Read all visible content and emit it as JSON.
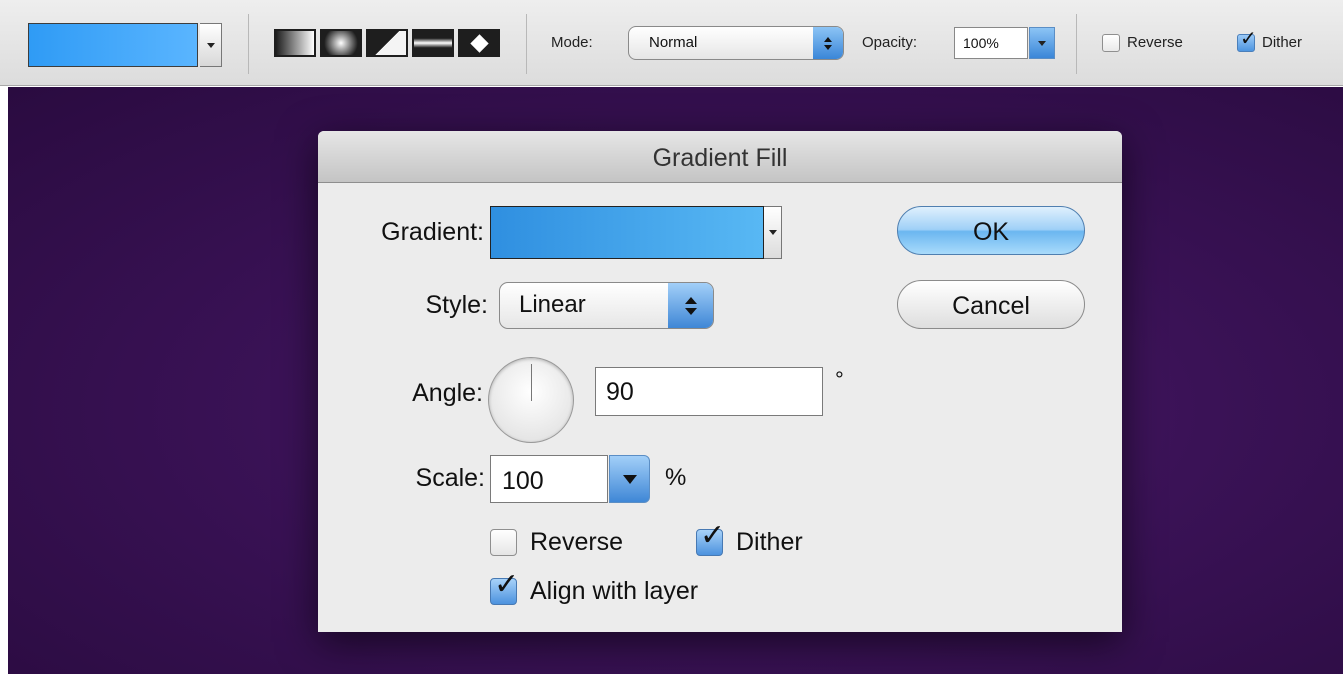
{
  "toolbar": {
    "gradient_colors": [
      "#2f9bf5",
      "#5ab5ff"
    ],
    "gradient_types": [
      "linear-gradient-icon",
      "radial-gradient-icon",
      "angle-gradient-icon",
      "reflected-gradient-icon",
      "diamond-gradient-icon"
    ],
    "mode_label": "Mode:",
    "mode_value": "Normal",
    "opacity_label": "Opacity:",
    "opacity_value": "100%",
    "reverse_label": "Reverse",
    "reverse_checked": false,
    "dither_label": "Dither",
    "dither_checked": true
  },
  "canvas": {
    "background_color": "#3a1256"
  },
  "dialog": {
    "title": "Gradient Fill",
    "gradient_label": "Gradient:",
    "gradient_colors": [
      "#2f8fe0",
      "#58b8f4"
    ],
    "style_label": "Style:",
    "style_value": "Linear",
    "angle_label": "Angle:",
    "angle_value": "90",
    "angle_unit": "°",
    "scale_label": "Scale:",
    "scale_value": "100",
    "scale_unit": "%",
    "reverse_label": "Reverse",
    "reverse_checked": false,
    "dither_label": "Dither",
    "dither_checked": true,
    "align_label": "Align with layer",
    "align_checked": true,
    "ok_label": "OK",
    "cancel_label": "Cancel"
  }
}
